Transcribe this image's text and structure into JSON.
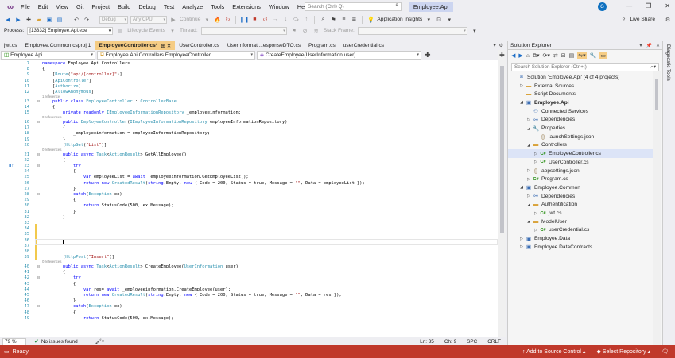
{
  "menubar": {
    "items": [
      "File",
      "Edit",
      "View",
      "Git",
      "Project",
      "Build",
      "Debug",
      "Test",
      "Analyze",
      "Tools",
      "Extensions",
      "Window",
      "Help"
    ],
    "search_placeholder": "Search (Ctrl+Q)",
    "solution_name": "Employee.Api",
    "avatar_initial": "G"
  },
  "toolbar": {
    "config": "Debug",
    "platform": "Any CPU",
    "continue_label": "Continue",
    "app_insights": "Application Insights",
    "live_share": "Live Share"
  },
  "debug_toolbar": {
    "process_label": "Process:",
    "process_value": "[13332] Employee.Api.exe",
    "lifecycle": "Lifecycle Events",
    "thread": "Thread:",
    "stack_frame": "Stack Frame:"
  },
  "tabs": [
    {
      "label": "jwt.cs",
      "active": false
    },
    {
      "label": "Employee.Common.csproj:1",
      "active": false
    },
    {
      "label": "EmployeeController.cs*",
      "active": true
    },
    {
      "label": "UserController.cs",
      "active": false
    },
    {
      "label": "UserInformati...esponseDTO.cs",
      "active": false
    },
    {
      "label": "Program.cs",
      "active": false
    },
    {
      "label": "userCredential.cs",
      "active": false
    }
  ],
  "navbar": {
    "project": "Employee.Api",
    "class": "Employee.Api.Controllers.EmployeeController",
    "member": "CreateEmployee(UserInformation user)"
  },
  "code_lines": [
    {
      "n": "7",
      "t": "namespace Employee.Api.Controllers"
    },
    {
      "n": "8",
      "t": "{"
    },
    {
      "n": "9",
      "t": "    [Route(\"api/[controller]\")]"
    },
    {
      "n": "10",
      "t": "    [ApiController]"
    },
    {
      "n": "11",
      "t": "    [Authorize]"
    },
    {
      "n": "12",
      "t": "    [AllowAnonymous]",
      "refs": "1 reference"
    },
    {
      "n": "13",
      "t": "    public class EmployeeController : ControllerBase"
    },
    {
      "n": "14",
      "t": "    {"
    },
    {
      "n": "15",
      "t": "        private readonly IEmployeeInformationRepository _employeeinformation;",
      "refs": "0 references"
    },
    {
      "n": "16",
      "t": "        public EmployeeController(IEmployeeInformationRepository employeeInformationRepository)"
    },
    {
      "n": "17",
      "t": "        {"
    },
    {
      "n": "18",
      "t": "            _employeeinformation = employeeInformationRepository;"
    },
    {
      "n": "19",
      "t": "        }"
    },
    {
      "n": "20",
      "t": "        [HttpGet(\"List\")]",
      "refs": "0 references"
    },
    {
      "n": "21",
      "t": "        public async Task<ActionResult> GetAllEmployee()"
    },
    {
      "n": "22",
      "t": "        {"
    },
    {
      "n": "23",
      "t": "            try"
    },
    {
      "n": "24",
      "t": "            {"
    },
    {
      "n": "25",
      "t": "                var employeeList = await _employeeinformation.GetEmployeeList();"
    },
    {
      "n": "26",
      "t": "                return new CreatedResult(string.Empty, new { Code = 200, Status = true, Message = \"\", Data = employeeList });"
    },
    {
      "n": "27",
      "t": "            }"
    },
    {
      "n": "28",
      "t": "            catch(Exception ex)"
    },
    {
      "n": "29",
      "t": "            {"
    },
    {
      "n": "30",
      "t": "                return StatusCode(500, ex.Message);"
    },
    {
      "n": "31",
      "t": "            }"
    },
    {
      "n": "32",
      "t": "        }"
    },
    {
      "n": "33",
      "t": ""
    },
    {
      "n": "34",
      "t": ""
    },
    {
      "n": "35",
      "t": "        "
    },
    {
      "n": "36",
      "t": ""
    },
    {
      "n": "37",
      "t": ""
    },
    {
      "n": "38",
      "t": ""
    },
    {
      "n": "39",
      "t": "        [HttpPost(\"Insert\")]",
      "refs": "0 references"
    },
    {
      "n": "40",
      "t": "        public async Task<ActionResult> CreateEmployee(UserInformation user)"
    },
    {
      "n": "41",
      "t": "        {"
    },
    {
      "n": "42",
      "t": "            try"
    },
    {
      "n": "43",
      "t": "            {"
    },
    {
      "n": "44",
      "t": "                var res= await _employeeinformation.CreateEmployee(user);"
    },
    {
      "n": "45",
      "t": "                return new CreatedResult(string.Empty, new { Code = 200, Status = true, Message = \"\", Data = res });"
    },
    {
      "n": "46",
      "t": "            }"
    },
    {
      "n": "47",
      "t": "            catch(Exception ex)"
    },
    {
      "n": "48",
      "t": "            {"
    },
    {
      "n": "49",
      "t": "                return StatusCode(500, ex.Message);"
    }
  ],
  "editor_status": {
    "zoom": "79 %",
    "issues": "No issues found",
    "ln": "Ln: 35",
    "ch": "Ch: 9",
    "spc": "SPC",
    "crlf": "CRLF"
  },
  "solution_explorer": {
    "title": "Solution Explorer",
    "search_placeholder": "Search Solution Explorer (Ctrl+;)",
    "nodes": [
      {
        "label": "Solution 'Employee.Api' (4 of 4 projects)",
        "level": 0,
        "icon": "solution",
        "tw": ""
      },
      {
        "label": "External Sources",
        "level": 1,
        "icon": "folder",
        "tw": "▷"
      },
      {
        "label": "Script Documents",
        "level": 1,
        "icon": "folder",
        "tw": ""
      },
      {
        "label": "Employee.Api",
        "level": 1,
        "icon": "proj",
        "tw": "◢",
        "bold": true
      },
      {
        "label": "Connected Services",
        "level": 2,
        "icon": "svc",
        "tw": ""
      },
      {
        "label": "Dependencies",
        "level": 2,
        "icon": "deps",
        "tw": "▷"
      },
      {
        "label": "Properties",
        "level": 2,
        "icon": "prop",
        "tw": "◢"
      },
      {
        "label": "launchSettings.json",
        "level": 3,
        "icon": "json",
        "tw": ""
      },
      {
        "label": "Controllers",
        "level": 2,
        "icon": "folder",
        "tw": "◢"
      },
      {
        "label": "EmployeeController.cs",
        "level": 3,
        "icon": "cs",
        "tw": "▷",
        "selected": true
      },
      {
        "label": "UserController.cs",
        "level": 3,
        "icon": "cs",
        "tw": "▷"
      },
      {
        "label": "appsettings.json",
        "level": 2,
        "icon": "json",
        "tw": "▷"
      },
      {
        "label": "Program.cs",
        "level": 2,
        "icon": "cs",
        "tw": "▷"
      },
      {
        "label": "Employee.Common",
        "level": 1,
        "icon": "proj",
        "tw": "◢"
      },
      {
        "label": "Dependencies",
        "level": 2,
        "icon": "deps",
        "tw": "▷"
      },
      {
        "label": "Authentification",
        "level": 2,
        "icon": "folder",
        "tw": "◢"
      },
      {
        "label": "jwt.cs",
        "level": 3,
        "icon": "cs",
        "tw": "▷"
      },
      {
        "label": "ModelUser",
        "level": 2,
        "icon": "folder",
        "tw": "◢"
      },
      {
        "label": "userCredential.cs",
        "level": 3,
        "icon": "cs",
        "tw": "▷"
      },
      {
        "label": "Employee.Data",
        "level": 1,
        "icon": "proj",
        "tw": "▷"
      },
      {
        "label": "Employee.DataContracts",
        "level": 1,
        "icon": "proj",
        "tw": "▷"
      }
    ]
  },
  "diagnostic_tools": "Diagnostic Tools",
  "statusbar": {
    "ready": "Ready",
    "source_control": "Add to Source Control",
    "repo": "Select Repository"
  },
  "colors": {
    "statusbar_bg": "#c0392b",
    "active_tab_bg": "#f5cc84",
    "keyword": "#0000ff",
    "type": "#2b91af",
    "string": "#a31515"
  }
}
